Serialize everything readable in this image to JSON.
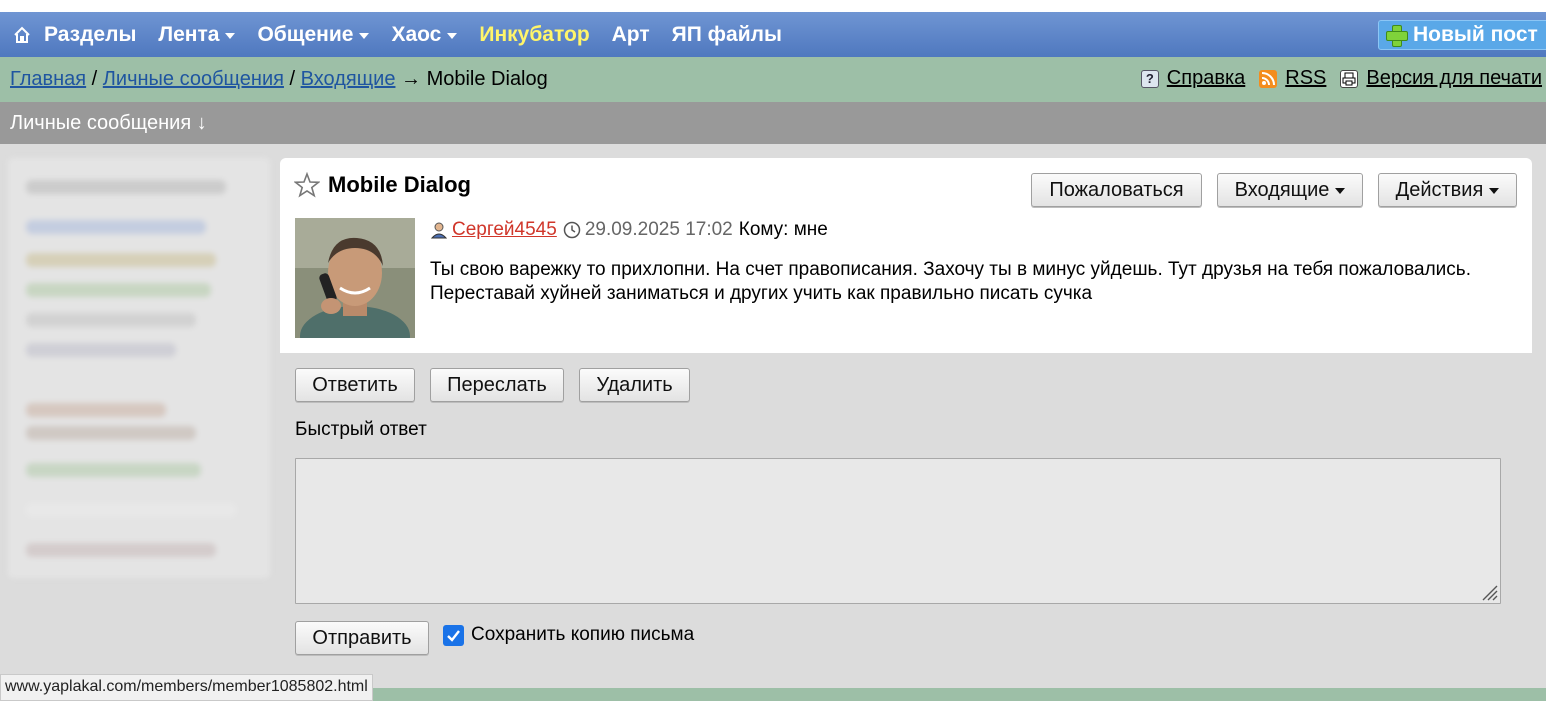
{
  "nav": {
    "items": [
      {
        "label": "Разделы",
        "caret": false
      },
      {
        "label": "Лента",
        "caret": true
      },
      {
        "label": "Общение",
        "caret": true
      },
      {
        "label": "Хаос",
        "caret": true
      },
      {
        "label": "Инкубатор",
        "caret": false,
        "highlight": true
      },
      {
        "label": "Арт",
        "caret": false
      },
      {
        "label": "ЯП файлы",
        "caret": false
      }
    ],
    "new_post": "Новый пост"
  },
  "breadcrumb": {
    "home": "Главная",
    "messages": "Личные сообщения",
    "inbox": "Входящие",
    "sep1": " / ",
    "sep2": " / ",
    "arrow": " → ",
    "current": "Mobile Dialog"
  },
  "tools": {
    "help": "Справка",
    "rss": "RSS",
    "print": "Версия для печати"
  },
  "section": {
    "title": "Личные сообщения ↓"
  },
  "message": {
    "title": "Mobile Dialog",
    "author": "Сергей4545",
    "datetime": "29.09.2025 17:02",
    "to": "Кому: мне",
    "body": "Ты свою варежку то прихлопни. На счет правописания. Захочу ты в минус уйдешь. Тут друзья на тебя пожаловались. Переставай хуйней заниматься и других учить как правильно писать сучка"
  },
  "header_buttons": {
    "report": "Пожаловаться",
    "inbox": "Входящие",
    "actions": "Действия"
  },
  "action_buttons": {
    "reply": "Ответить",
    "forward": "Переслать",
    "delete": "Удалить"
  },
  "quick_reply": {
    "label": "Быстрый ответ",
    "value": "",
    "send": "Отправить",
    "save_copy": "Сохранить копию письма",
    "save_copy_checked": true
  },
  "status_bar": {
    "url": "www.yaplakal.com/members/member1085802.html"
  },
  "colors": {
    "nav": "#5a83c8",
    "crumbbar": "#9dbfa7",
    "section": "#999999",
    "accent": "#fff56a",
    "author": "#d0362a",
    "link": "#1f55a0"
  }
}
